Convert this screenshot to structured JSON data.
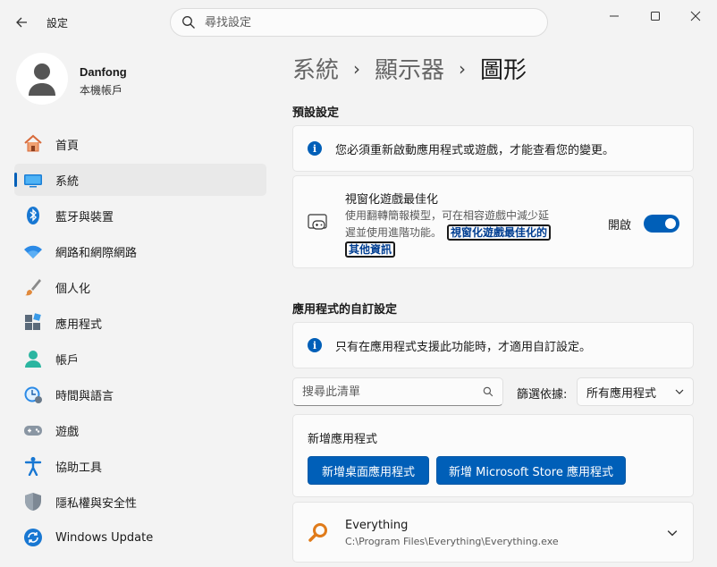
{
  "window": {
    "title": "設定",
    "search_placeholder": "尋找設定"
  },
  "profile": {
    "name": "Danfong",
    "subtitle": "本機帳戶"
  },
  "nav": [
    {
      "label": "首頁",
      "icon": "home-icon"
    },
    {
      "label": "系統",
      "icon": "system-icon",
      "active": true
    },
    {
      "label": "藍牙與裝置",
      "icon": "bluetooth-icon"
    },
    {
      "label": "網路和網際網路",
      "icon": "wifi-icon"
    },
    {
      "label": "個人化",
      "icon": "brush-icon"
    },
    {
      "label": "應用程式",
      "icon": "apps-icon"
    },
    {
      "label": "帳戶",
      "icon": "account-icon"
    },
    {
      "label": "時間與語言",
      "icon": "time-language-icon"
    },
    {
      "label": "遊戲",
      "icon": "gamepad-icon"
    },
    {
      "label": "協助工具",
      "icon": "accessibility-icon"
    },
    {
      "label": "隱私權與安全性",
      "icon": "shield-icon"
    },
    {
      "label": "Windows Update",
      "icon": "update-icon"
    }
  ],
  "breadcrumb": {
    "level1": "系統",
    "level2": "顯示器",
    "current": "圖形",
    "separator": "›"
  },
  "defaults": {
    "section_title": "預設設定",
    "info_text": "您必須重新啟動應用程式或遊戲，才能查看您的變更。",
    "windowed_opt": {
      "title": "視窗化遊戲最佳化",
      "desc_line1": "使用翻轉簡報模型，可在相容遊戲中減少延",
      "desc_line2": "遲並使用進階功能。",
      "link_part1": "視窗化遊戲最佳化的",
      "link_part2": "其他資訊",
      "state_label": "開啟",
      "enabled": true
    }
  },
  "custom": {
    "section_title": "應用程式的自訂設定",
    "info_text": "只有在應用程式支援此功能時，才適用自訂設定。",
    "search_placeholder": "搜尋此清單",
    "filter_label": "篩選依據:",
    "filter_value": "所有應用程式",
    "add_app_title": "新增應用程式",
    "add_desktop_btn": "新增桌面應用程式",
    "add_store_btn": "新增 Microsoft Store 應用程式",
    "apps": [
      {
        "name": "Everything",
        "path": "C:\\Program Files\\Everything\\Everything.exe"
      }
    ]
  },
  "colors": {
    "accent": "#005fb8",
    "background": "#f3f3f3",
    "card": "#fbfbfb"
  }
}
